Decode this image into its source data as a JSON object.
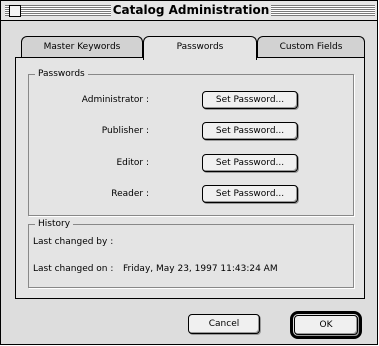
{
  "window": {
    "title": "Catalog Administration"
  },
  "tabs": [
    {
      "label": "Master Keywords"
    },
    {
      "label": "Passwords",
      "active": true
    },
    {
      "label": "Custom Fields"
    }
  ],
  "passwords_group": {
    "title": "Passwords",
    "rows": [
      {
        "label": "Administrator :",
        "button": "Set Password..."
      },
      {
        "label": "Publisher :",
        "button": "Set Password..."
      },
      {
        "label": "Editor :",
        "button": "Set Password..."
      },
      {
        "label": "Reader :",
        "button": "Set Password..."
      }
    ]
  },
  "history_group": {
    "title": "History",
    "last_changed_by_label": "Last changed by :",
    "last_changed_by_value": "",
    "last_changed_on_label": "Last changed on :",
    "last_changed_on_value": "Friday, May 23, 1997 11:43:24 AM"
  },
  "buttons": {
    "cancel": "Cancel",
    "ok": "OK"
  }
}
